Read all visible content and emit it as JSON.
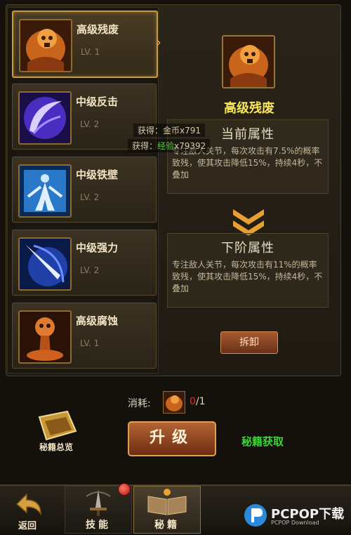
{
  "skills": [
    {
      "name": "高级残废",
      "level": "LV. 1",
      "icon": "orange-skull-cloak-icon",
      "selected": true
    },
    {
      "name": "中级反击",
      "level": "LV. 2",
      "icon": "purple-slash-icon",
      "selected": false
    },
    {
      "name": "中级铁壁",
      "level": "LV. 2",
      "icon": "blue-figure-shield-icon",
      "selected": false
    },
    {
      "name": "中级强力",
      "level": "LV. 2",
      "icon": "blue-spear-icon",
      "selected": false
    },
    {
      "name": "高级腐蚀",
      "level": "LV. 1",
      "icon": "orange-corrosion-skull-icon",
      "selected": false
    }
  ],
  "detail": {
    "title": "高级残废",
    "current_header": "当前属性",
    "current_text": "专注敌人关节，每次攻击有7.5%的概率致残，使其攻击降低15%，持续4秒，不叠加",
    "next_header": "下阶属性",
    "next_text": "专注敌人关节，每次攻击有11%的概率致残，使其攻击降低15%，持续4秒，不叠加",
    "remove_label": "拆卸"
  },
  "rewards": {
    "gold_prefix": "获得：",
    "gold": "金币x791",
    "xp_prefix": "获得：",
    "xp_label": "经验",
    "xp_value": "x79392"
  },
  "cost": {
    "label": "消耗:",
    "have": "0",
    "need": "/1"
  },
  "actions": {
    "upgrade_label": "升级",
    "get_link": "秘籍获取",
    "overview_label": "秘籍总览"
  },
  "nav": {
    "back_label": "返回",
    "tab_skill": "技能",
    "tab_book": "秘籍"
  },
  "watermark": {
    "text": "PCPOP下载",
    "sub": "PCPOP Download"
  },
  "colors": {
    "title_yellow": "#f8e55a",
    "xp_green": "#5ac847",
    "link_green": "#3ed23a",
    "cost_red": "#e0302a",
    "gold_border": "#c59a45"
  }
}
